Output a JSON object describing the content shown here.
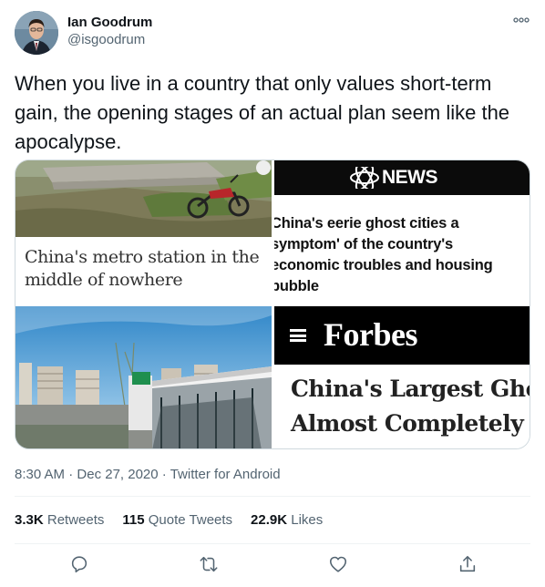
{
  "author": {
    "display_name": "Ian Goodrum",
    "handle": "@isgoodrum",
    "avatar_icon": "user-avatar"
  },
  "tweet": {
    "text": "When you live in a country that only values short-term gain, the opening stages of an actual plan seem like the apocalypse."
  },
  "media": {
    "tile1": {
      "caption_line1": "China's metro station in the",
      "caption_line2": "middle of nowhere"
    },
    "tile2": {
      "brand_logo_icon": "abc-logo",
      "brand": "NEWS",
      "headline_lines": [
        "China's eerie ghost cities a",
        "symptom' of the country's",
        "economic troubles and housing",
        "bubble"
      ]
    },
    "tile3": {
      "description_icon": "metro-station-photo"
    },
    "tile4": {
      "brand": "Forbes",
      "headline_line1": "China's Largest Ghost",
      "headline_line2": "Almost Completely F"
    }
  },
  "meta": {
    "time": "8:30 AM",
    "separator": "·",
    "date": "Dec 27, 2020",
    "source": "Twitter for Android"
  },
  "stats": {
    "retweets_count": "3.3K",
    "retweets_label": "Retweets",
    "quotes_count": "115",
    "quotes_label": "Quote Tweets",
    "likes_count": "22.9K",
    "likes_label": "Likes"
  },
  "colors": {
    "text_primary": "#0f1419",
    "text_secondary": "#536471",
    "icon_gray": "#536471",
    "border": "#cfd9de"
  }
}
